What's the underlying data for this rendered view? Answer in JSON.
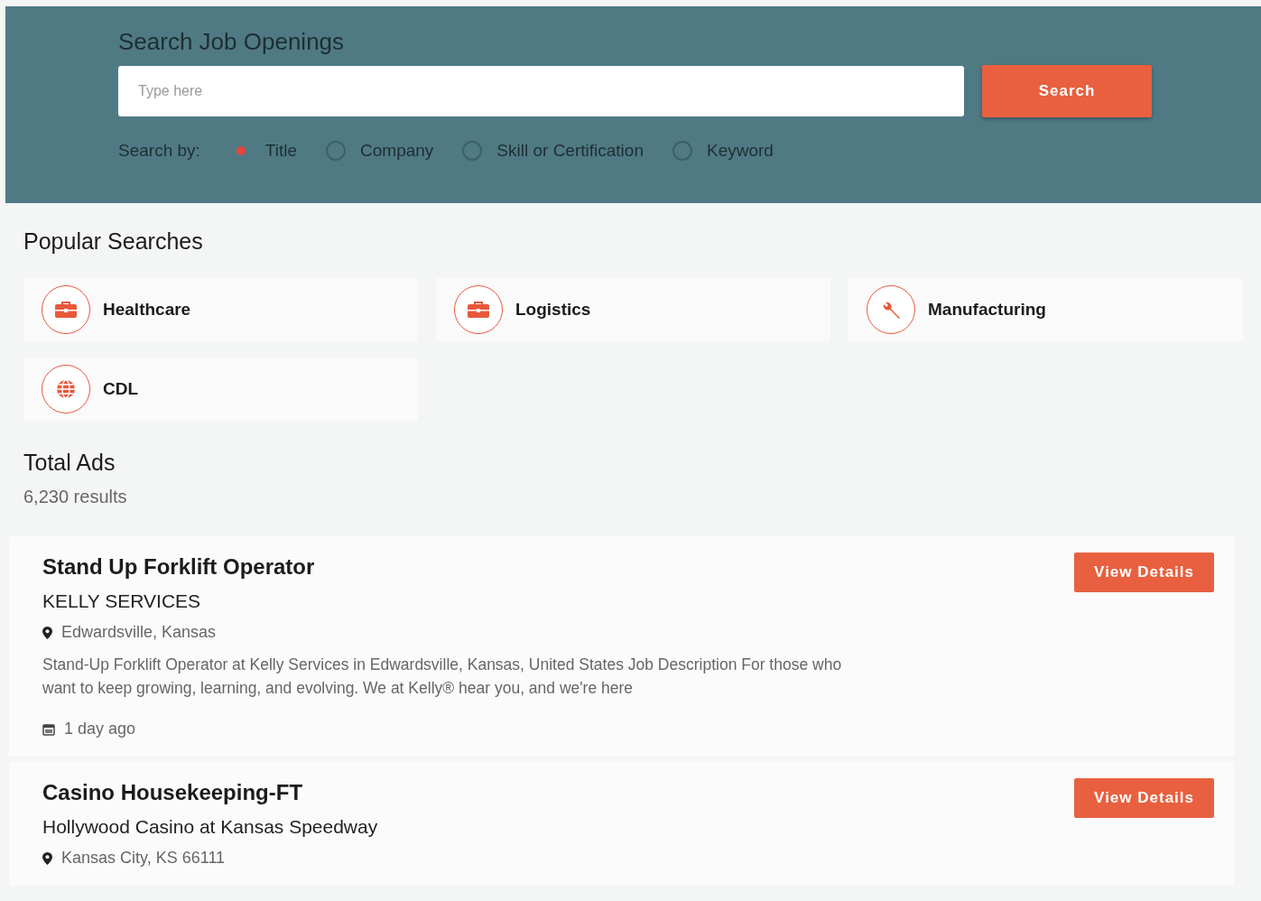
{
  "search": {
    "title": "Search Job Openings",
    "placeholder": "Type here",
    "button": "Search",
    "search_by_label": "Search by:",
    "options": [
      {
        "label": "Title",
        "selected": true
      },
      {
        "label": "Company",
        "selected": false
      },
      {
        "label": "Skill or Certification",
        "selected": false
      },
      {
        "label": "Keyword",
        "selected": false
      }
    ]
  },
  "popular_searches": {
    "title": "Popular Searches",
    "items": [
      {
        "label": "Healthcare"
      },
      {
        "label": "Logistics"
      },
      {
        "label": "Manufacturing"
      },
      {
        "label": "CDL"
      }
    ]
  },
  "total_ads": {
    "title": "Total Ads",
    "count": "6,230 results"
  },
  "jobs": [
    {
      "title": "Stand Up Forklift Operator",
      "company": "KELLY SERVICES",
      "location": "Edwardsville, Kansas",
      "description": "Stand-Up Forklift Operator at Kelly Services in Edwardsville, Kansas, United States Job Description For those who want to keep growing, learning, and evolving. We at Kelly® hear you, and we're here",
      "posted": "1 day ago",
      "button": "View Details"
    },
    {
      "title": "Casino Housekeeping-FT",
      "company": "Hollywood Casino at Kansas Speedway",
      "location": "Kansas City, KS 66111",
      "button": "View Details"
    }
  ]
}
